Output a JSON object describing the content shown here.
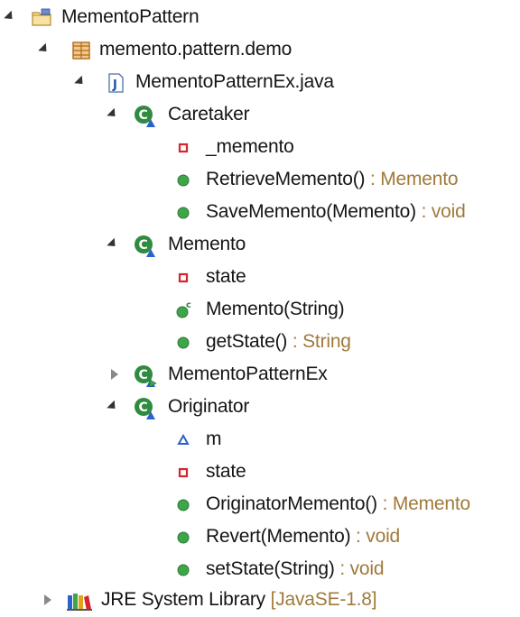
{
  "tree": {
    "project": {
      "label": "MementoPattern",
      "icon": "project-folder-icon",
      "expanded": true
    },
    "package": {
      "label": "memento.pattern.demo",
      "icon": "package-icon",
      "expanded": true
    },
    "file": {
      "label": "MementoPatternEx.java",
      "icon": "java-file-icon",
      "expanded": true
    },
    "caretaker": {
      "label": "Caretaker",
      "icon": "class-icon",
      "expanded": true,
      "members": [
        {
          "name": "_memento",
          "type": "",
          "icon": "private-field-icon"
        },
        {
          "name": "RetrieveMemento()",
          "type": " : Memento",
          "icon": "public-method-icon"
        },
        {
          "name": "SaveMemento(Memento)",
          "type": " : void",
          "icon": "public-method-icon"
        }
      ]
    },
    "memento": {
      "label": "Memento",
      "icon": "class-icon",
      "expanded": true,
      "members": [
        {
          "name": "state",
          "type": "",
          "icon": "private-field-icon"
        },
        {
          "name": "Memento(String)",
          "type": "",
          "icon": "constructor-icon"
        },
        {
          "name": "getState()",
          "type": " : String",
          "icon": "public-method-icon"
        }
      ]
    },
    "mementoPatternEx": {
      "label": "MementoPatternEx",
      "icon": "main-class-icon",
      "expanded": false
    },
    "originator": {
      "label": "Originator",
      "icon": "class-icon",
      "expanded": true,
      "members": [
        {
          "name": "m",
          "type": "",
          "icon": "default-field-icon"
        },
        {
          "name": "state",
          "type": "",
          "icon": "private-field-icon"
        },
        {
          "name": "OriginatorMemento()",
          "type": " : Memento",
          "icon": "public-method-icon"
        },
        {
          "name": "Revert(Memento)",
          "type": " : void",
          "icon": "public-method-icon"
        },
        {
          "name": "setState(String)",
          "type": " : void",
          "icon": "public-method-icon"
        }
      ]
    },
    "jre": {
      "label": "JRE System Library",
      "version": " [JavaSE-1.8]",
      "icon": "library-icon",
      "expanded": false
    }
  },
  "colors": {
    "type_text": "#a07a3a",
    "method_green": "#3ea54a",
    "private_red": "#d8232a",
    "class_green": "#2f8b3f",
    "field_blue": "#2a62c9"
  }
}
